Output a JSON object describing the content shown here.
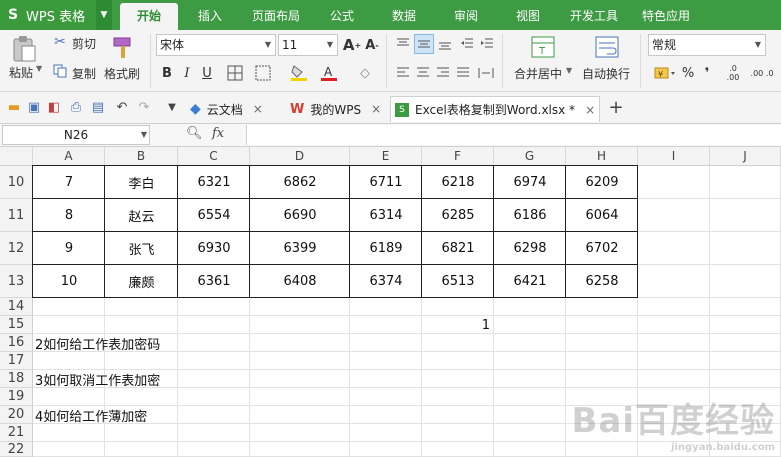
{
  "app": {
    "name": "WPS 表格"
  },
  "menu": {
    "tabs": [
      "开始",
      "插入",
      "页面布局",
      "公式",
      "数据",
      "审阅",
      "视图",
      "开发工具",
      "特色应用"
    ],
    "active": "开始"
  },
  "ribbon": {
    "paste": "粘贴",
    "cut": "剪切",
    "copy": "复制",
    "format_painter": "格式刷",
    "font_name": "宋体",
    "font_size": "11",
    "merge_center": "合并居中",
    "wrap_text": "自动换行",
    "number_format": "常规",
    "percent": "%",
    "comma": "❜",
    "inc_decimal": ".0 .00",
    "dec_decimal": ".00 .0"
  },
  "doc_tabs": [
    {
      "label": "云文档",
      "icon": "cloud-doc-icon"
    },
    {
      "label": "我的WPS",
      "icon": "wps-logo-icon"
    },
    {
      "label": "Excel表格复制到Word.xlsx *",
      "icon": "spreadsheet-file-icon",
      "active": true
    }
  ],
  "formula_bar": {
    "name_box": "N26",
    "fx": "fx",
    "formula": ""
  },
  "sheet": {
    "columns": [
      "A",
      "B",
      "C",
      "D",
      "E",
      "F",
      "G",
      "H",
      "I",
      "J"
    ],
    "rows": [
      "10",
      "11",
      "12",
      "13",
      "14",
      "15",
      "16",
      "17",
      "18",
      "19",
      "20",
      "21",
      "22"
    ],
    "table": [
      [
        "7",
        "李白",
        "6321",
        "6862",
        "6711",
        "6218",
        "6974",
        "6209"
      ],
      [
        "8",
        "赵云",
        "6554",
        "6690",
        "6314",
        "6285",
        "6186",
        "6064"
      ],
      [
        "9",
        "张飞",
        "6930",
        "6399",
        "6189",
        "6821",
        "6298",
        "6702"
      ],
      [
        "10",
        "廉颇",
        "6361",
        "6408",
        "6374",
        "6513",
        "6421",
        "6258"
      ]
    ],
    "f15": "1",
    "a16": "2如何给工作表加密码",
    "a18": "3如何取消工作表加密",
    "a20": "4如何给工作薄加密"
  },
  "watermark": {
    "main": "Bai百度经验",
    "sub": "jingyan.baidu.com"
  },
  "colors": {
    "menu_green": "#3d9b43",
    "active_tab_text": "#2d8c34"
  }
}
